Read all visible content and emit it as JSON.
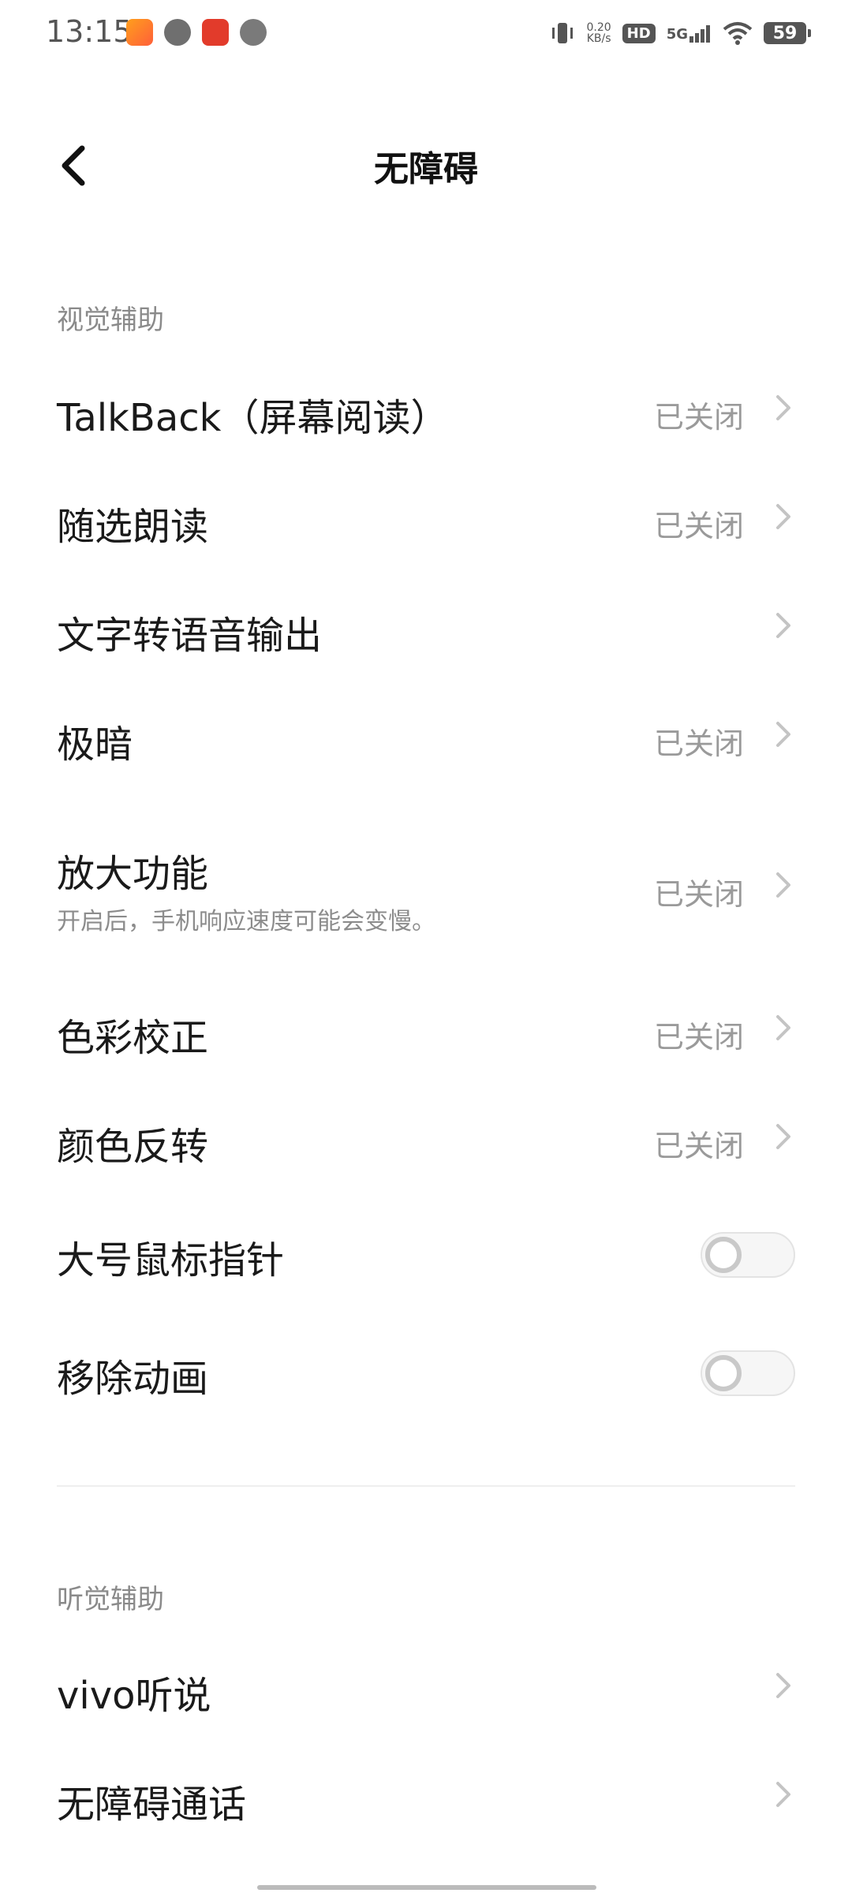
{
  "status_bar": {
    "time": "13:15",
    "net_speed_value": "0.20",
    "net_speed_unit": "KB/s",
    "hd": "HD",
    "network": "5G",
    "battery": "59",
    "icons": [
      "app-icon",
      "chat-icon",
      "video-icon",
      "link-icon",
      "vibrate-icon",
      "signal-icon",
      "wifi-icon",
      "battery-icon"
    ]
  },
  "header": {
    "title": "无障碍"
  },
  "sections": {
    "vision": {
      "title": "视觉辅助",
      "items": [
        {
          "label": "TalkBack（屏幕阅读）",
          "status": "已关闭"
        },
        {
          "label": "随选朗读",
          "status": "已关闭"
        },
        {
          "label": "文字转语音输出",
          "status": ""
        },
        {
          "label": "极暗",
          "status": "已关闭"
        },
        {
          "label": "放大功能",
          "subtext": "开启后，手机响应速度可能会变慢。",
          "status": "已关闭"
        },
        {
          "label": "色彩校正",
          "status": "已关闭"
        },
        {
          "label": "颜色反转",
          "status": "已关闭"
        },
        {
          "label": "大号鼠标指针",
          "toggle": false
        },
        {
          "label": "移除动画",
          "toggle": false
        }
      ]
    },
    "hearing": {
      "title": "听觉辅助",
      "items": [
        {
          "label": "vivo听说"
        },
        {
          "label": "无障碍通话"
        }
      ]
    }
  }
}
